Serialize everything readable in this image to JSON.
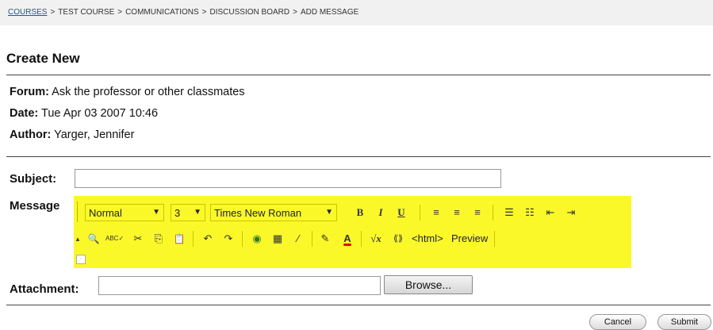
{
  "breadcrumb": {
    "items": [
      "COURSES",
      "TEST COURSE",
      "COMMUNICATIONS",
      "DISCUSSION BOARD",
      "ADD MESSAGE"
    ],
    "separator": ">"
  },
  "page": {
    "title": "Create New"
  },
  "info": {
    "forum_label": "Forum:",
    "forum_value": "Ask the professor or other classmates",
    "date_label": "Date:",
    "date_value": "Tue Apr 03 2007 10:46",
    "author_label": "Author:",
    "author_value": "Yarger, Jennifer"
  },
  "form": {
    "subject_label": "Subject:",
    "subject_value": "",
    "message_label": "Message",
    "attachment_label": "Attachment:",
    "browse_label": "Browse...",
    "cancel_label": "Cancel",
    "submit_label": "Submit"
  },
  "editor": {
    "background_color": "#fbf82a",
    "format_value": "Normal",
    "size_value": "3",
    "font_value": "Times New Roman",
    "bold": "B",
    "italic": "I",
    "underline": "U",
    "html_label": "<html>",
    "preview_label": "Preview",
    "color_letter": "A",
    "resize_glyph": "·"
  },
  "icons": {
    "select_arrow": "▼",
    "align_left": "≡",
    "align_center": "≡",
    "align_right": "≡",
    "numbered_list": "☰",
    "bulleted_list": "☷",
    "outdent": "⇤",
    "indent": "⇥",
    "collapse": "▴",
    "preview": "🔍",
    "spellcheck": "ABC✓",
    "cut": "✂",
    "copy": "⎘",
    "paste": "📋",
    "undo": "↶",
    "redo": "↷",
    "link": "◉",
    "table": "▦",
    "pen": "∕",
    "eraser": "✎",
    "sqrt": "√x",
    "anchor": "⟪⟫"
  }
}
